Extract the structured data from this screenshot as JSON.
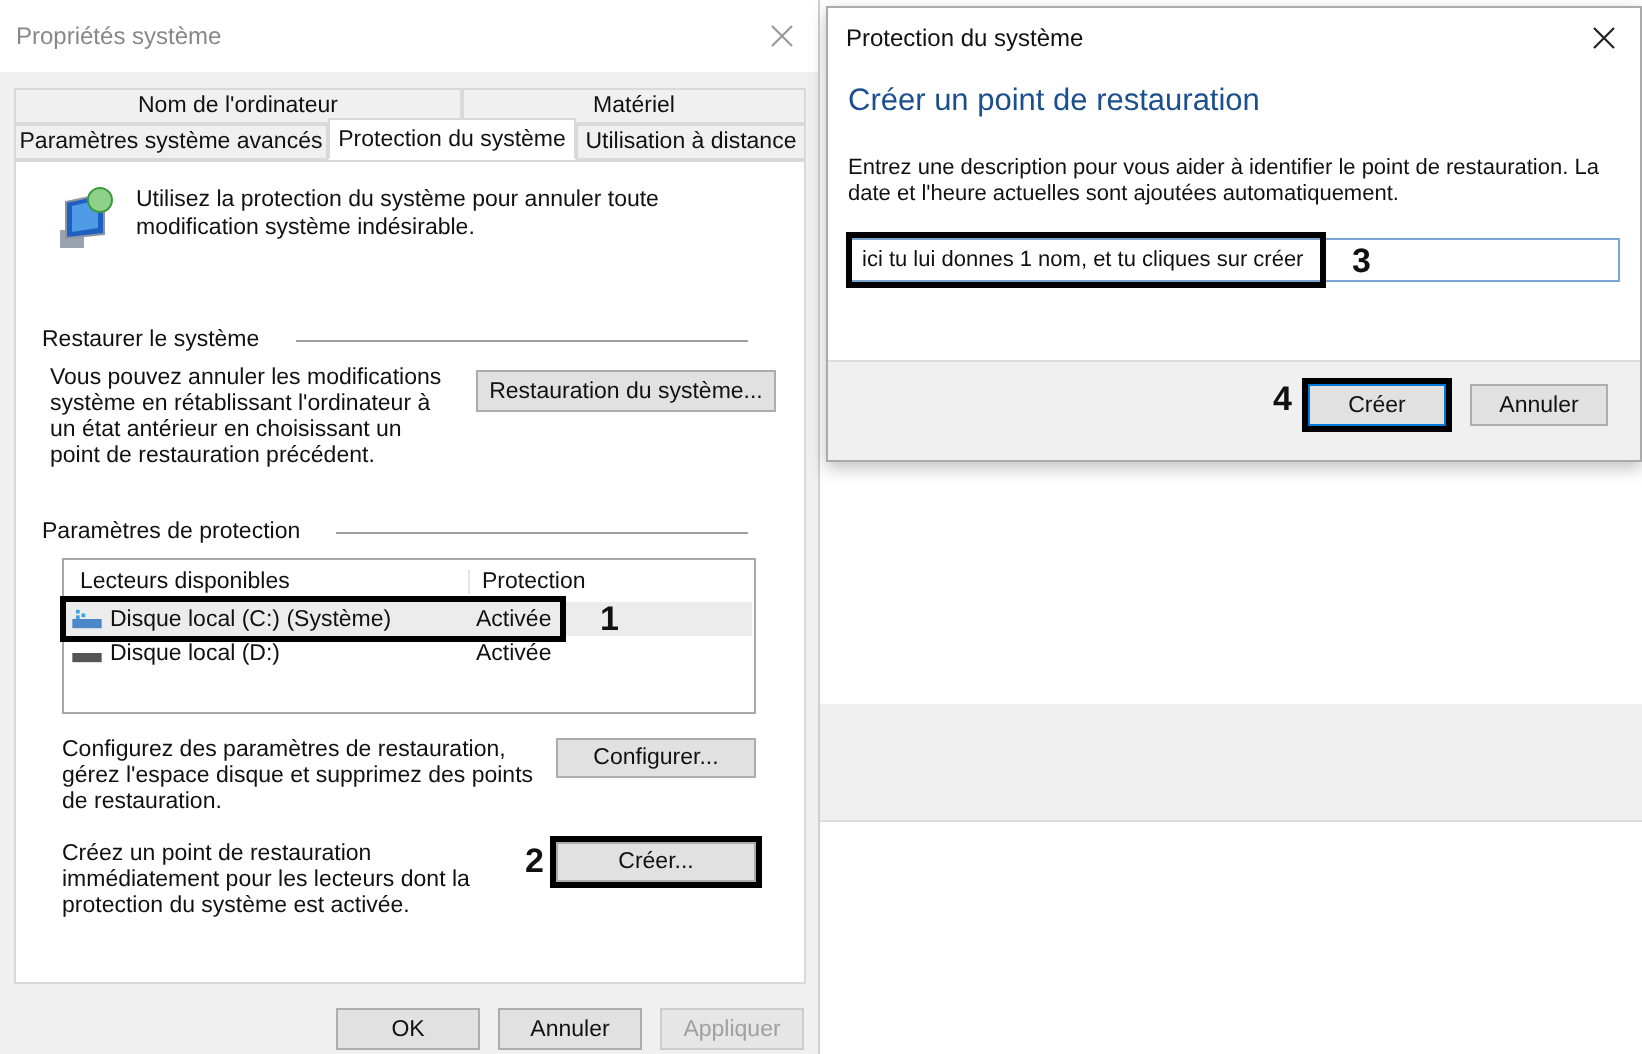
{
  "left_window": {
    "title": "Propriétés système",
    "tabs_row_1": [
      {
        "label": "Nom de l'ordinateur",
        "selected": false
      },
      {
        "label": "Matériel",
        "selected": false
      }
    ],
    "tabs_row_2": [
      {
        "label": "Paramètres système avancés",
        "selected": false
      },
      {
        "label": "Protection du système",
        "selected": true
      },
      {
        "label": "Utilisation à distance",
        "selected": false
      }
    ],
    "intro": "Utilisez la protection du système pour annuler toute modification système indésirable.",
    "restore_section": {
      "heading": "Restaurer le système",
      "text": "Vous pouvez annuler les modifications système en rétablissant l'ordinateur à un état antérieur en choisissant un point de restauration précédent.",
      "button": "Restauration du système..."
    },
    "protection_section": {
      "heading": "Paramètres de protection",
      "columns": [
        "Lecteurs disponibles",
        "Protection"
      ],
      "drives": [
        {
          "name": "Disque local (C:) (Système)",
          "protection": "Activée",
          "selected": true,
          "kind": "system",
          "callout": "1"
        },
        {
          "name": "Disque local (D:)",
          "protection": "Activée",
          "selected": false,
          "kind": "data"
        }
      ],
      "configure_text": "Configurez des paramètres de restauration, gérez l'espace disque et supprimez des points de restauration.",
      "configure_button": "Configurer...",
      "create_text": "Créez un point de restauration immédiatement pour les lecteurs dont la protection du système est activée.",
      "create_button": {
        "label": "Créer...",
        "callout": "2"
      }
    },
    "buttons": [
      {
        "label": "OK",
        "disabled": false
      },
      {
        "label": "Annuler",
        "disabled": false
      },
      {
        "label": "Appliquer",
        "disabled": true
      }
    ]
  },
  "dialog": {
    "title": "Protection du système",
    "heading": "Créer un point de restauration",
    "text": "Entrez une description pour vous aider à identifier le point de restauration. La date et l'heure actuelles sont ajoutées automatiquement.",
    "input": {
      "value": "ici tu lui donnes 1 nom, et tu cliques sur créer",
      "callout": "3"
    },
    "buttons": [
      {
        "label": "Créer",
        "default": true,
        "callout": "4"
      },
      {
        "label": "Annuler",
        "default": false
      }
    ]
  }
}
